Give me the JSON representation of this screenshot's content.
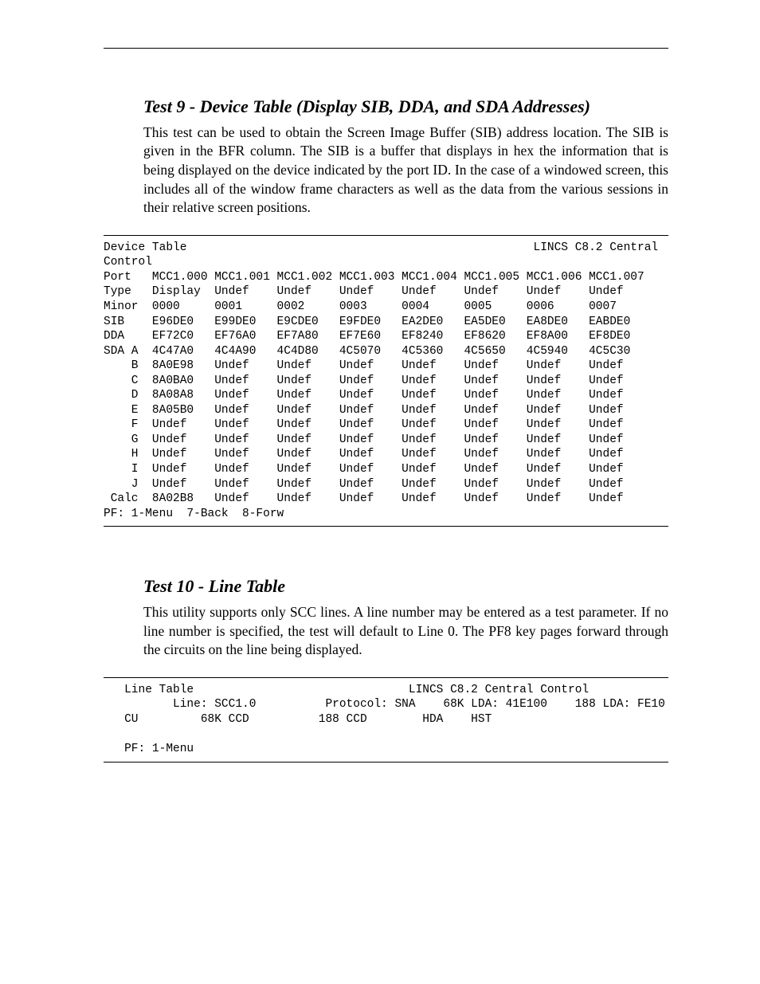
{
  "section1": {
    "title": "Test 9 - Device Table (Display SIB, DDA, and SDA Addresses)",
    "para": "This test can be used to obtain the Screen Image Buffer (SIB) address location. The SIB is given in the BFR column. The SIB is a buffer that displays in hex the information that is being displayed on the device indicated by the port ID. In the case of a windowed screen, this includes all of the window frame characters as well as the data from the various sessions in their relative screen positions.",
    "term": {
      "header_left": "Device Table",
      "header_right": "LINCS C8.2 Central",
      "header_second": "Control",
      "columns": [
        "Port",
        "MCC1.000",
        "MCC1.001",
        "MCC1.002",
        "MCC1.003",
        "MCC1.004",
        "MCC1.005",
        "MCC1.006",
        "MCC1.007"
      ],
      "rows": [
        {
          "label": "Type",
          "cells": [
            "Display",
            "Undef",
            "Undef",
            "Undef",
            "Undef",
            "Undef",
            "Undef",
            "Undef"
          ]
        },
        {
          "label": "Minor",
          "cells": [
            "0000",
            "0001",
            "0002",
            "0003",
            "0004",
            "0005",
            "0006",
            "0007"
          ]
        },
        {
          "label": "SIB",
          "cells": [
            "E96DE0",
            "E99DE0",
            "E9CDE0",
            "E9FDE0",
            "EA2DE0",
            "EA5DE0",
            "EA8DE0",
            "EABDE0"
          ]
        },
        {
          "label": "DDA",
          "cells": [
            "EF72C0",
            "EF76A0",
            "EF7A80",
            "EF7E60",
            "EF8240",
            "EF8620",
            "EF8A00",
            "EF8DE0"
          ]
        },
        {
          "label": "SDA A",
          "cells": [
            "4C47A0",
            "4C4A90",
            "4C4D80",
            "4C5070",
            "4C5360",
            "4C5650",
            "4C5940",
            "4C5C30"
          ]
        },
        {
          "label": "    B",
          "cells": [
            "8A0E98",
            "Undef",
            "Undef",
            "Undef",
            "Undef",
            "Undef",
            "Undef",
            "Undef"
          ]
        },
        {
          "label": "    C",
          "cells": [
            "8A0BA0",
            "Undef",
            "Undef",
            "Undef",
            "Undef",
            "Undef",
            "Undef",
            "Undef"
          ]
        },
        {
          "label": "    D",
          "cells": [
            "8A08A8",
            "Undef",
            "Undef",
            "Undef",
            "Undef",
            "Undef",
            "Undef",
            "Undef"
          ]
        },
        {
          "label": "    E",
          "cells": [
            "8A05B0",
            "Undef",
            "Undef",
            "Undef",
            "Undef",
            "Undef",
            "Undef",
            "Undef"
          ]
        },
        {
          "label": "    F",
          "cells": [
            "Undef",
            "Undef",
            "Undef",
            "Undef",
            "Undef",
            "Undef",
            "Undef",
            "Undef"
          ]
        },
        {
          "label": "    G",
          "cells": [
            "Undef",
            "Undef",
            "Undef",
            "Undef",
            "Undef",
            "Undef",
            "Undef",
            "Undef"
          ]
        },
        {
          "label": "    H",
          "cells": [
            "Undef",
            "Undef",
            "Undef",
            "Undef",
            "Undef",
            "Undef",
            "Undef",
            "Undef"
          ]
        },
        {
          "label": "    I",
          "cells": [
            "Undef",
            "Undef",
            "Undef",
            "Undef",
            "Undef",
            "Undef",
            "Undef",
            "Undef"
          ]
        },
        {
          "label": "    J",
          "cells": [
            "Undef",
            "Undef",
            "Undef",
            "Undef",
            "Undef",
            "Undef",
            "Undef",
            "Undef"
          ]
        },
        {
          "label": " Calc",
          "cells": [
            "8A02B8",
            "Undef",
            "Undef",
            "Undef",
            "Undef",
            "Undef",
            "Undef",
            "Undef"
          ]
        }
      ],
      "footer": "PF: 1-Menu  7-Back  8-Forw"
    }
  },
  "section2": {
    "title": "Test 10 - Line Table",
    "para": "This utility supports only SCC lines. A line number may be entered as a test parameter. If no line number is specified, the test will default to Line 0. The PF8 key pages forward through the circuits on the line being displayed.",
    "term": {
      "line1_left": "   Line Table",
      "line1_right": "LINCS C8.2 Central Control",
      "line2": {
        "line_label": "Line:",
        "line_val": "SCC1.0",
        "proto_label": "Protocol:",
        "proto_val": "SNA",
        "lda68_label": "68K LDA:",
        "lda68_val": "41E100",
        "lda188_label": "188 LDA:",
        "lda188_val": "FE10"
      },
      "line3": {
        "cu": "CU",
        "c68": "68K CCD",
        "c188": "188 CCD",
        "hda": "HDA",
        "hst": "HST"
      },
      "footer": "   PF: 1-Menu"
    }
  }
}
